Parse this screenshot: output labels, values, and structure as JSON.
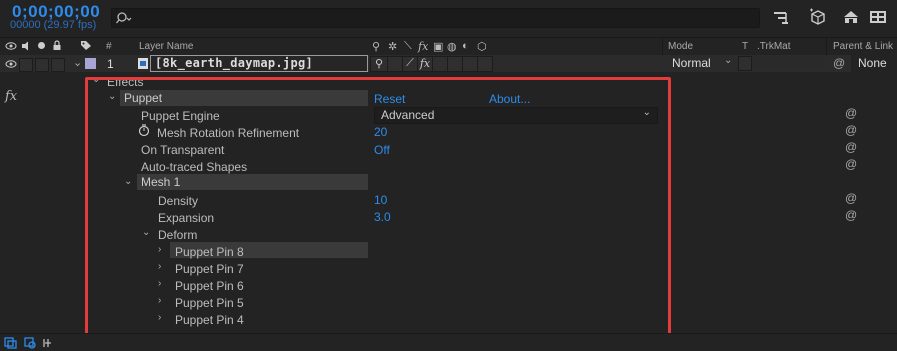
{
  "timecode": "0;00;00;00",
  "frame_info": "00000 (29.97 fps)",
  "search": {
    "placeholder": "",
    "icon": "search-icon"
  },
  "toolbar_icons": [
    "composition-flowchart-icon",
    "3d-layer-icon",
    "shy-layers-icon",
    "frame-blending-icon"
  ],
  "header": {
    "switch_icons": [
      "eye-icon",
      "audio-icon",
      "solo-icon",
      "lock-icon"
    ],
    "label_icon": "label-tag-icon",
    "num": "#",
    "layer_name": "Layer Name",
    "mode": "Mode",
    "t": "T",
    "trkmat": ".TrkMat",
    "parent": "Parent & Link"
  },
  "layer": {
    "number": "1",
    "name": "[8k_earth_daymap.jpg]",
    "mode": "Normal",
    "parent": "None"
  },
  "fx_label": "fx",
  "tree": {
    "effects": "Effects",
    "puppet": "Puppet",
    "reset": "Reset",
    "about": "About...",
    "puppet_engine": "Puppet Engine",
    "puppet_engine_value": "Advanced",
    "mesh_rotation": "Mesh Rotation Refinement",
    "mesh_rotation_value": "20",
    "on_transparent": "On Transparent",
    "on_transparent_value": "Off",
    "auto_traced": "Auto-traced Shapes",
    "mesh1": "Mesh 1",
    "density": "Density",
    "density_value": "10",
    "expansion": "Expansion",
    "expansion_value": "3.0",
    "deform": "Deform",
    "pins": [
      "Puppet Pin 8",
      "Puppet Pin 7",
      "Puppet Pin 6",
      "Puppet Pin 5",
      "Puppet Pin 4"
    ]
  },
  "colors": {
    "accent_blue": "#2d8ceb",
    "highlight_box": "#e23c3c",
    "label_swatch": "#a9a4d6"
  }
}
